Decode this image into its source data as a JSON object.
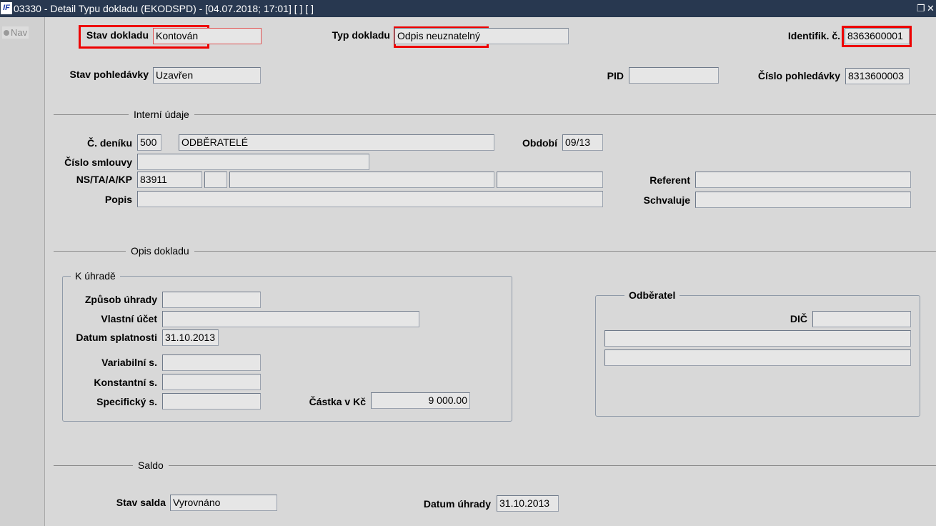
{
  "window": {
    "title": "03330 - Detail Typu dokladu (EKODSPD) - [04.07.2018; 17:01]  [ ]  [ ]",
    "logo": "IF",
    "restore_icon": "restore-icon",
    "close_icon": "close-icon"
  },
  "sidebar": {
    "nav_label": "Nav"
  },
  "header": {
    "stav_dokladu": {
      "label": "Stav dokladu",
      "value": "Kontován"
    },
    "typ_dokladu": {
      "label": "Typ dokladu",
      "value": "Odpis neuznatelný"
    },
    "identifik": {
      "label": "Identifik. č.",
      "value": "8363600001"
    },
    "stav_pohledavky": {
      "label": "Stav pohledávky",
      "value": "Uzavřen"
    },
    "pid": {
      "label": "PID",
      "value": ""
    },
    "cislo_pohledavky": {
      "label": "Číslo pohledávky",
      "value": "8313600003"
    }
  },
  "interni": {
    "title": "Interní údaje",
    "c_deniku": {
      "label": "Č. deníku",
      "code": "500",
      "name": "ODBĚRATELÉ"
    },
    "obdobi": {
      "label": "Období",
      "value": "09/13"
    },
    "cislo_smlouvy": {
      "label": "Číslo smlouvy",
      "value": ""
    },
    "ns": {
      "label": "NS/TA/A/KP",
      "values": [
        "83911",
        "",
        "",
        ""
      ]
    },
    "referent": {
      "label": "Referent",
      "value": ""
    },
    "popis": {
      "label": "Popis",
      "value": ""
    },
    "schvaluje": {
      "label": "Schvaluje",
      "value": ""
    }
  },
  "opis": {
    "title": "Opis dokladu",
    "k_uhrade": {
      "title": "K úhradě",
      "zpusob": {
        "label": "Způsob úhrady",
        "value": ""
      },
      "ucet": {
        "label": "Vlastní účet",
        "value": ""
      },
      "splatnost": {
        "label": "Datum splatnosti",
        "value": "31.10.2013"
      },
      "vs": {
        "label": "Variabilní s.",
        "value": ""
      },
      "ks": {
        "label": "Konstantní s.",
        "value": ""
      },
      "ss": {
        "label": "Specifický s.",
        "value": ""
      },
      "castka": {
        "label": "Částka v Kč",
        "value": "9 000.00"
      }
    },
    "odberatel": {
      "title": "Odběratel",
      "dic": {
        "label": "DIČ",
        "value": ""
      },
      "line1": "",
      "line2": ""
    }
  },
  "saldo": {
    "title": "Saldo",
    "stav": {
      "label": "Stav salda",
      "value": "Vyrovnáno"
    },
    "datum": {
      "label": "Datum úhrady",
      "value": "31.10.2013"
    }
  }
}
